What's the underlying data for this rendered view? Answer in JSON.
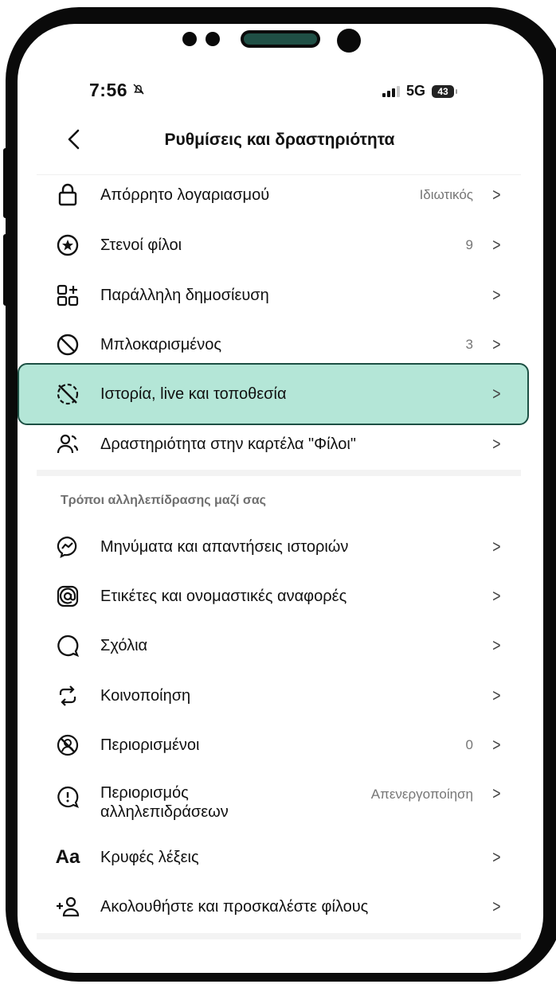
{
  "status_bar": {
    "time": "7:56",
    "network": "5G",
    "battery": "43"
  },
  "header": {
    "back_label": "<",
    "title": "Ρυθμίσεις και δραστηριότητα"
  },
  "chevron": ">",
  "privacy_section": [
    {
      "label": "Απόρρητο λογαριασμού",
      "value": "Ιδιωτικός",
      "icon": "lock-icon"
    },
    {
      "label": "Στενοί φίλοι",
      "value": "9",
      "icon": "star-circle-icon"
    },
    {
      "label": "Παράλληλη δημοσίευση",
      "value": "",
      "icon": "grid-plus-icon"
    },
    {
      "label": "Μπλοκαρισμένος",
      "value": "3",
      "icon": "blocked-icon"
    },
    {
      "label": "Ιστορία, live και τοποθεσία",
      "value": "",
      "icon": "story-hidden-icon",
      "highlighted": true
    },
    {
      "label": "Δραστηριότητα στην καρτέλα \"Φίλοι\"",
      "value": "",
      "icon": "friends-activity-icon"
    }
  ],
  "interactions_section": {
    "title": "Τρόποι αλληλεπίδρασης μαζί σας",
    "items": [
      {
        "label": "Μηνύματα και απαντήσεις ιστοριών",
        "value": "",
        "icon": "messenger-icon"
      },
      {
        "label": "Ετικέτες και ονομαστικές αναφορές",
        "value": "",
        "icon": "at-sign-icon"
      },
      {
        "label": "Σχόλια",
        "value": "",
        "icon": "comment-icon"
      },
      {
        "label": "Κοινοποίηση",
        "value": "",
        "icon": "share-icon"
      },
      {
        "label": "Περιορισμένοι",
        "value": "0",
        "icon": "restricted-icon"
      },
      {
        "label_line1": "Περιορισμός",
        "label_line2": "αλληλεπιδράσεων",
        "value": "Απενεργοποίηση",
        "icon": "limit-interactions-icon"
      },
      {
        "label": "Κρυφές λέξεις",
        "value": "",
        "icon_text": "Aa",
        "icon": "hidden-words-icon"
      },
      {
        "label": "Ακολουθήστε και προσκαλέστε φίλους",
        "value": "",
        "icon": "add-friend-icon"
      }
    ]
  },
  "colors": {
    "highlight_bg": "#b4e6d7",
    "highlight_border": "#1d5044"
  }
}
